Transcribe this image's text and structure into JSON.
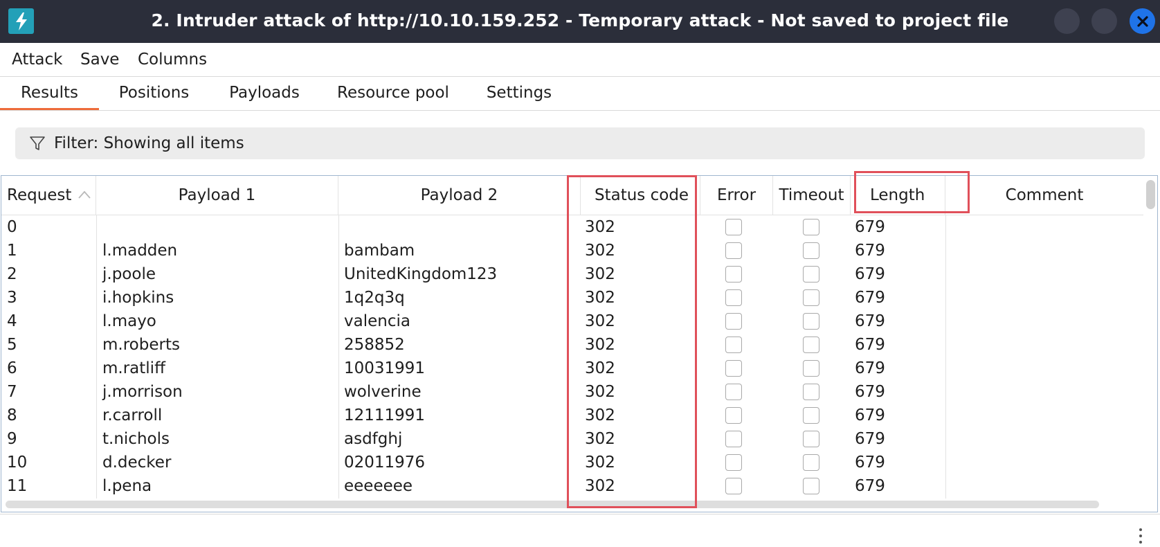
{
  "window": {
    "title": "2. Intruder attack of http://10.10.159.252 - Temporary attack - Not saved to project file",
    "app_icon": "burp-lightning-icon"
  },
  "menu": [
    "Attack",
    "Save",
    "Columns"
  ],
  "tabs": [
    "Results",
    "Positions",
    "Payloads",
    "Resource pool",
    "Settings"
  ],
  "active_tab": "Results",
  "filter": {
    "label": "Filter: Showing all items"
  },
  "table": {
    "columns": [
      "Request",
      "Payload 1",
      "Payload 2",
      "Status code",
      "Error",
      "Timeout",
      "Length",
      "Comment"
    ],
    "sorted_column": "Request",
    "rows": [
      {
        "request": "0",
        "payload1": "",
        "payload2": "",
        "status": "302",
        "error": false,
        "timeout": false,
        "length": "679"
      },
      {
        "request": "1",
        "payload1": "l.madden",
        "payload2": "bambam",
        "status": "302",
        "error": false,
        "timeout": false,
        "length": "679"
      },
      {
        "request": "2",
        "payload1": "j.poole",
        "payload2": "UnitedKingdom123",
        "status": "302",
        "error": false,
        "timeout": false,
        "length": "679"
      },
      {
        "request": "3",
        "payload1": "i.hopkins",
        "payload2": "1q2q3q",
        "status": "302",
        "error": false,
        "timeout": false,
        "length": "679"
      },
      {
        "request": "4",
        "payload1": "l.mayo",
        "payload2": "valencia",
        "status": "302",
        "error": false,
        "timeout": false,
        "length": "679"
      },
      {
        "request": "5",
        "payload1": "m.roberts",
        "payload2": "258852",
        "status": "302",
        "error": false,
        "timeout": false,
        "length": "679"
      },
      {
        "request": "6",
        "payload1": "m.ratliff",
        "payload2": "10031991",
        "status": "302",
        "error": false,
        "timeout": false,
        "length": "679"
      },
      {
        "request": "7",
        "payload1": "j.morrison",
        "payload2": "wolverine",
        "status": "302",
        "error": false,
        "timeout": false,
        "length": "679"
      },
      {
        "request": "8",
        "payload1": "r.carroll",
        "payload2": "12111991",
        "status": "302",
        "error": false,
        "timeout": false,
        "length": "679"
      },
      {
        "request": "9",
        "payload1": "t.nichols",
        "payload2": "asdfghj",
        "status": "302",
        "error": false,
        "timeout": false,
        "length": "679"
      },
      {
        "request": "10",
        "payload1": "d.decker",
        "payload2": "02011976",
        "status": "302",
        "error": false,
        "timeout": false,
        "length": "679"
      },
      {
        "request": "11",
        "payload1": "l.pena",
        "payload2": "eeeeeee",
        "status": "302",
        "error": false,
        "timeout": false,
        "length": "679"
      }
    ]
  },
  "colors": {
    "titlebar": "#2b2e3a",
    "accent_tab": "#ee6c3a",
    "close_button": "#1f73e8",
    "highlight_box": "#e0505a"
  }
}
